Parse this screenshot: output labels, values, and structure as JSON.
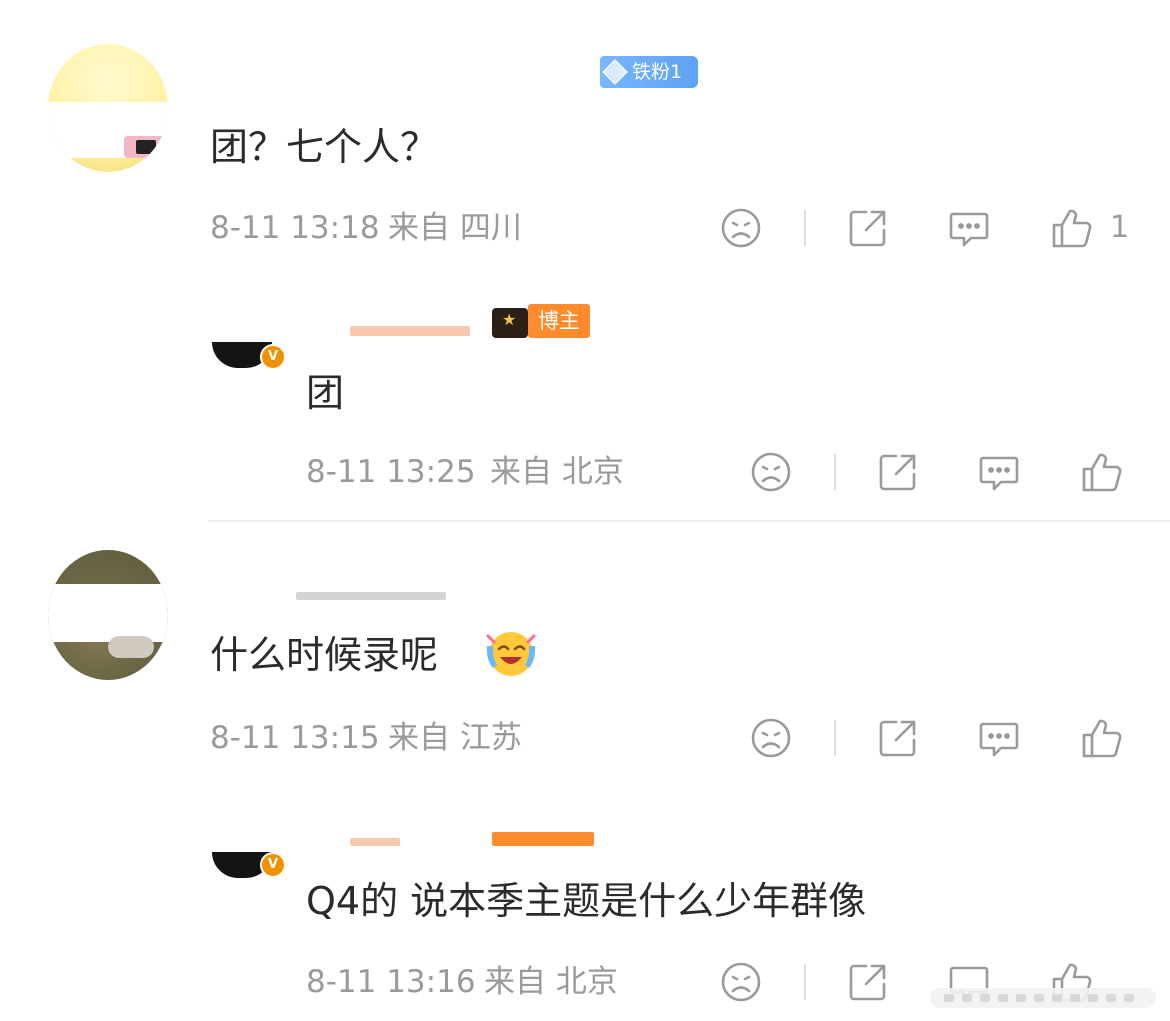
{
  "comments": [
    {
      "badge": "铁粉1",
      "text": "团？七个人？",
      "time": "8-11 13:18",
      "location": "来自 四川",
      "like_count": "1",
      "reply": {
        "role_badge": "博主",
        "verified_mark": "V",
        "text": "团",
        "time": "8-11 13:25",
        "location": "来自 北京"
      }
    },
    {
      "text": "什么时候录呢",
      "emoji_icon": "laughing-tears-emoji",
      "time": "8-11 13:15",
      "location": "来自 江苏",
      "reply": {
        "verified_mark": "V",
        "text": "Q4的 说本季主题是什么少年群像",
        "time": "8-11 13:16",
        "location": "来自 北京"
      }
    }
  ],
  "icons": {
    "dislike": "sad-face-icon",
    "share": "share-icon",
    "comment": "comment-bubble-icon",
    "like": "thumbs-up-icon"
  },
  "colors": {
    "fan_badge": "#6aaaf7",
    "blogger_badge": "#ff8b2c",
    "verified": "#f29100",
    "meta_text": "#9a9a9a",
    "body_text": "#2b2b2b"
  }
}
